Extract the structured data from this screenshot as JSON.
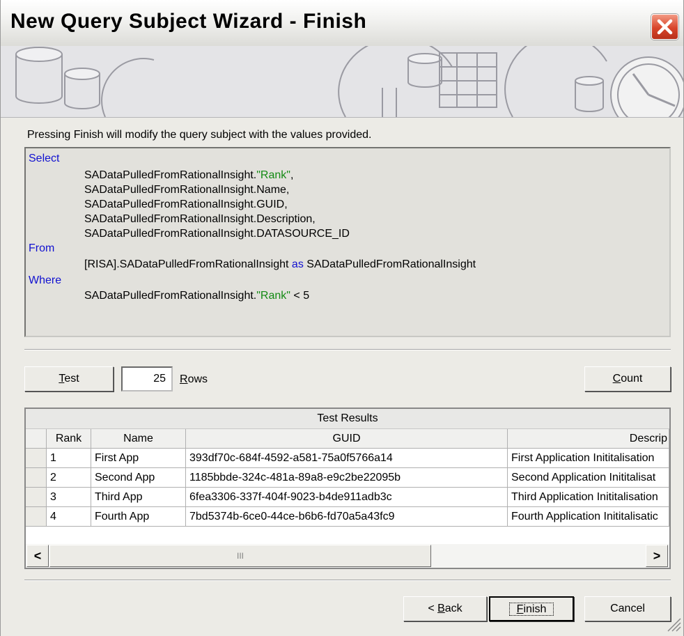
{
  "window": {
    "title": "New Query Subject Wizard - Finish"
  },
  "info_text": "Pressing Finish will modify the query subject with the values provided.",
  "sql": {
    "select_kw": "Select",
    "select_lines": [
      {
        "prefix": "SADataPulledFromRationalInsight.",
        "quoted": "\"Rank\"",
        "suffix": ","
      },
      {
        "prefix": "SADataPulledFromRationalInsight.Name,",
        "quoted": "",
        "suffix": ""
      },
      {
        "prefix": "SADataPulledFromRationalInsight.GUID,",
        "quoted": "",
        "suffix": ""
      },
      {
        "prefix": "SADataPulledFromRationalInsight.Description,",
        "quoted": "",
        "suffix": ""
      },
      {
        "prefix": "SADataPulledFromRationalInsight.DATASOURCE_ID",
        "quoted": "",
        "suffix": ""
      }
    ],
    "from_kw": "From",
    "from_source": "[RISA].SADataPulledFromRationalInsight",
    "as_kw": "as",
    "from_alias": "SADataPulledFromRationalInsight",
    "where_kw": "Where",
    "where_prefix": "SADataPulledFromRationalInsight.",
    "where_quoted": "\"Rank\"",
    "where_suffix": " < 5"
  },
  "test_bar": {
    "test_pre": "",
    "test_accel": "T",
    "test_post": "est",
    "rows_value": "25",
    "rows_accel": "R",
    "rows_post": "ows",
    "count_accel": "C",
    "count_post": "ount"
  },
  "results": {
    "caption": "Test Results",
    "columns": [
      "Rank",
      "Name",
      "GUID",
      "Descrip"
    ],
    "rows": [
      [
        "1",
        "First App",
        "393df70c-684f-4592-a581-75a0f5766a14",
        "First Application Inititalisation"
      ],
      [
        "2",
        "Second App",
        "1185bbde-324c-481a-89a8-e9c2be22095b",
        "Second Application Inititalisat"
      ],
      [
        "3",
        "Third App",
        "6fea3306-337f-404f-9023-b4de911adb3c",
        "Third Application Inititalisation"
      ],
      [
        "4",
        "Fourth App",
        "7bd5374b-6ce0-44ce-b6b6-fd70a5a43fc9",
        "Fourth Application Inititalisatic"
      ]
    ],
    "scroll_left": "<",
    "scroll_right": ">",
    "thumb_grip": "III"
  },
  "buttons": {
    "back_pre": "< ",
    "back_accel": "B",
    "back_post": "ack",
    "finish_accel": "F",
    "finish_post": "inish",
    "cancel": "Cancel"
  },
  "colors": {
    "keyword": "#1111d0",
    "string": "#138a13",
    "close": "#d8452b"
  }
}
